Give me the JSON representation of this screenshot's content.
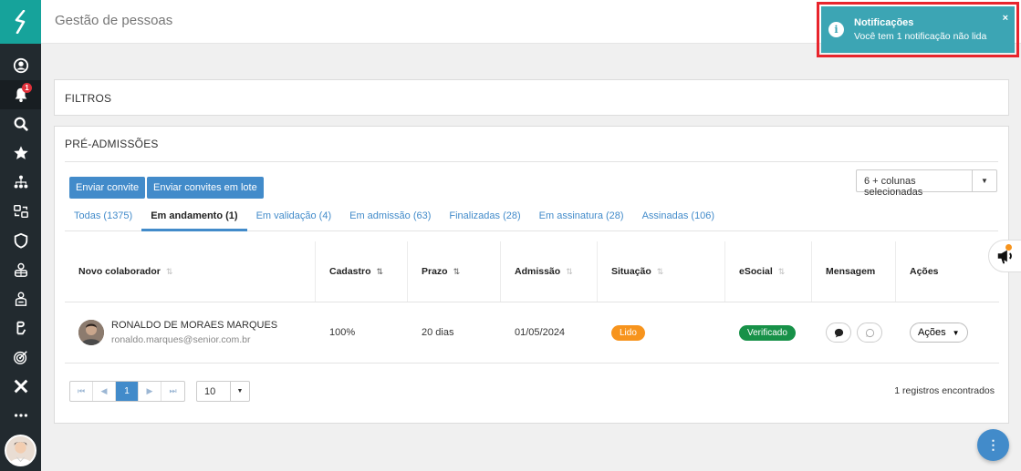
{
  "header": {
    "title": "Gestão de pessoas"
  },
  "sidebar": {
    "notification_count": "1",
    "items": [
      {
        "icon": "user-circle-icon"
      },
      {
        "icon": "bell-icon"
      },
      {
        "icon": "search-icon"
      },
      {
        "icon": "star-icon"
      },
      {
        "icon": "org-chart-icon"
      },
      {
        "icon": "people-switch-icon"
      },
      {
        "icon": "shield-icon"
      },
      {
        "icon": "team-icon"
      },
      {
        "icon": "badge-icon"
      },
      {
        "icon": "learning-icon"
      },
      {
        "icon": "target-icon"
      },
      {
        "icon": "x-logo-icon"
      },
      {
        "icon": "more-icon"
      }
    ]
  },
  "notification": {
    "title": "Notificações",
    "message": "Você tem 1 notificação não lida",
    "close": "×",
    "icon_glyph": "i"
  },
  "filters": {
    "title": "FILTROS"
  },
  "main": {
    "title": "PRÉ-ADMISSÕES",
    "invite_label": "Enviar convite",
    "batch_label": "Enviar convites em lote",
    "columns_select": "6 + colunas selecionadas",
    "tabs": [
      {
        "label": "Todas (1375)",
        "active": false
      },
      {
        "label": "Em andamento (1)",
        "active": true
      },
      {
        "label": "Em validação (4)",
        "active": false
      },
      {
        "label": "Em admissão (63)",
        "active": false
      },
      {
        "label": "Finalizadas (28)",
        "active": false
      },
      {
        "label": "Em assinatura (28)",
        "active": false
      },
      {
        "label": "Assinadas (106)",
        "active": false
      }
    ],
    "table": {
      "headers": [
        "Novo colaborador",
        "Cadastro",
        "Prazo",
        "Admissão",
        "Situação",
        "eSocial",
        "Mensagem",
        "Ações"
      ],
      "rows": [
        {
          "name": "RONALDO DE MORAES MARQUES",
          "email": "ronaldo.marques@senior.com.br",
          "cadastro": "100%",
          "prazo": "20 dias",
          "admissao": "01/05/2024",
          "situacao": "Lido",
          "esocial": "Verificado",
          "acoes": "Ações"
        }
      ]
    },
    "pagination": {
      "current_page": "1",
      "page_size": "10",
      "records": "1 registros encontrados"
    }
  },
  "colors": {
    "brand": "#16a39b",
    "primary": "#428bca",
    "notification": "#3ca5b4",
    "highlight": "#e8242c",
    "status_lido": "#f7941d",
    "status_verificado": "#179148"
  }
}
